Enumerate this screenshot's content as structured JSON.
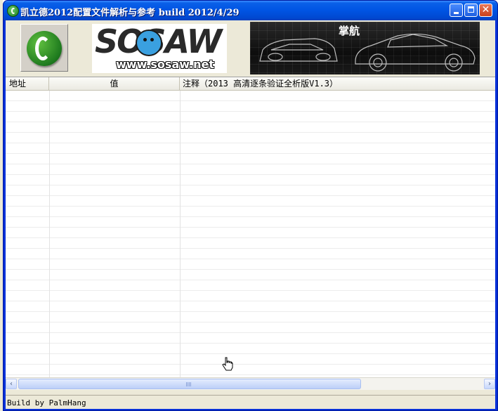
{
  "window": {
    "title": "凯立德2012配置文件解析与参考 build 2012/4/29",
    "buttons": {
      "minimize": "_",
      "maximize": "□",
      "close": "✕"
    }
  },
  "banner": {
    "brand_logo": "sosaw",
    "sosaw_text": "SOSAW",
    "sosaw_url": "www.sosaw.net",
    "car_label": "掌航"
  },
  "table": {
    "columns": [
      {
        "label": "地址"
      },
      {
        "label": "值"
      },
      {
        "label": "注释（2013 高清逐条验证全析版V1.3）"
      }
    ],
    "rows": []
  },
  "scrollbar": {
    "left_arrow": "‹",
    "right_arrow": "›"
  },
  "status_bar": {
    "text": "Build by PalmHang"
  },
  "icons": [
    "app-icon",
    "logo-icon",
    "hand-cursor-icon"
  ],
  "colors": {
    "titlebar": "#0054e3",
    "client": "#ece9d8",
    "logo_green": "#1e7a1e"
  }
}
